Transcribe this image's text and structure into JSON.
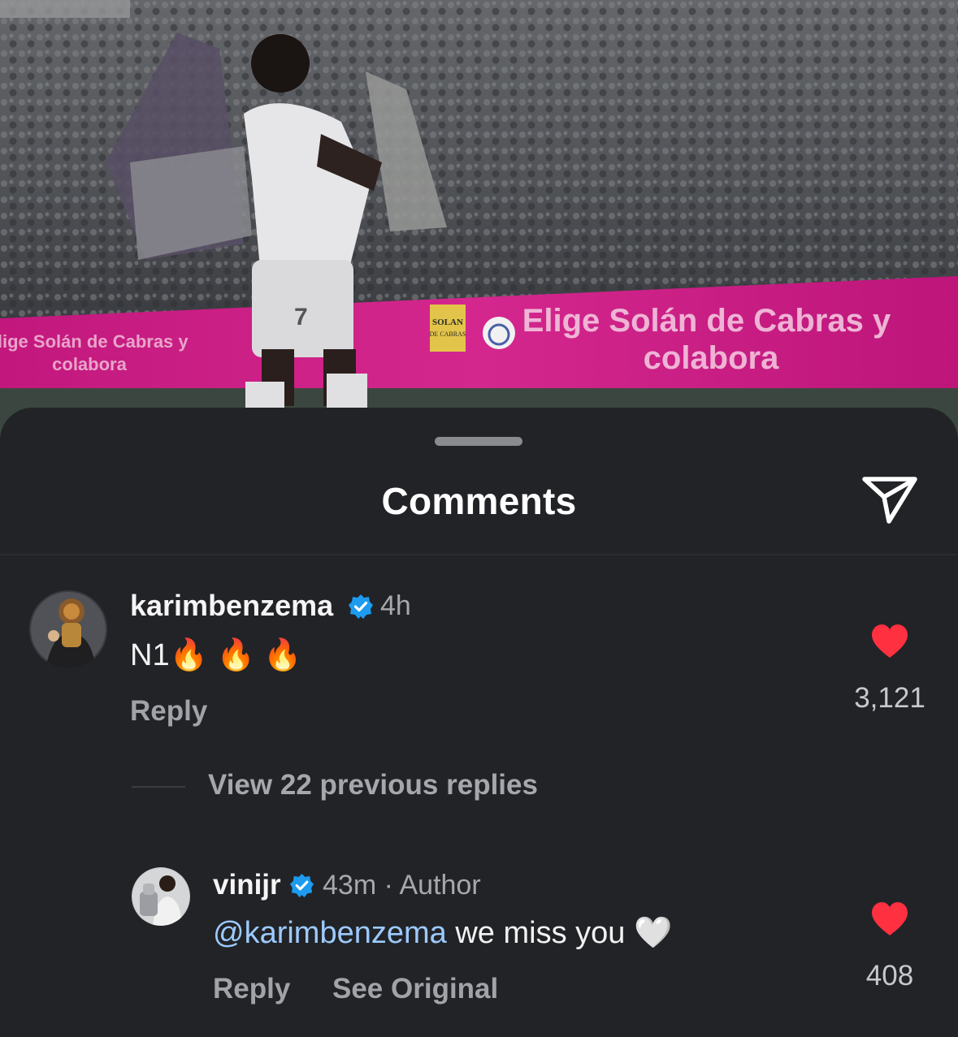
{
  "sheet": {
    "title": "Comments",
    "share_icon": "paper-plane-icon"
  },
  "photo": {
    "banner_left": "Elige Solán de Cabras y colabora",
    "banner_right_line1": "Elige Solán de Cabras y",
    "banner_right_line2": "colabora",
    "logo_text": "SOLAN DE CABRAS",
    "jersey_number": "7"
  },
  "comments": [
    {
      "username": "karimbenzema",
      "verified": true,
      "time": "4h",
      "text": "N1",
      "emoji": "🔥 🔥 🔥",
      "reply_label": "Reply",
      "likes": "3,121",
      "liked": true
    }
  ],
  "view_replies_label": "View 22 previous replies",
  "reply": {
    "username": "vinijr",
    "verified": true,
    "time": "43m · Author",
    "mention": "@karimbenzema",
    "text": " we miss you ",
    "emoji": "🤍",
    "reply_label": "Reply",
    "see_original_label": "See Original",
    "likes": "408",
    "liked": true
  },
  "colors": {
    "sheet_bg": "#222327",
    "like_red": "#ff3040",
    "verified_blue": "#1d9bf0",
    "mention_blue": "#9ccaff",
    "banner_pink": "#d11a85"
  }
}
